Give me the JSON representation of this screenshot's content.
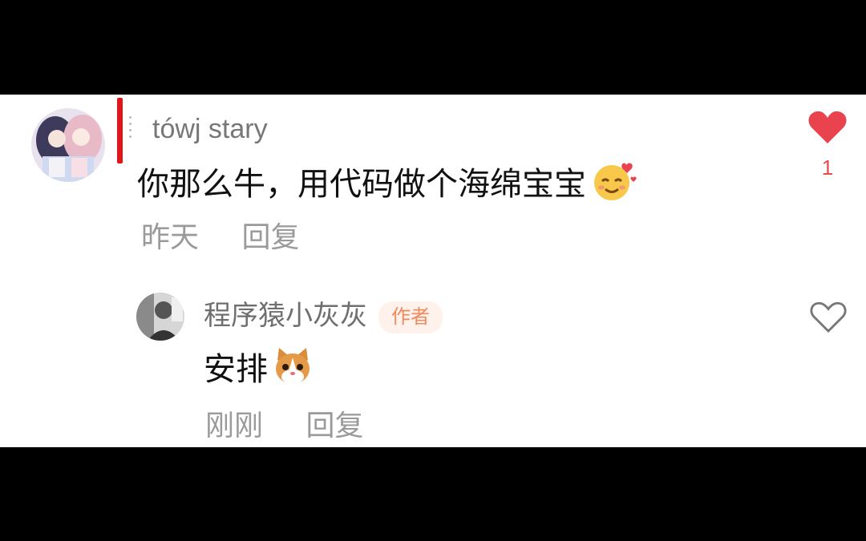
{
  "comments": [
    {
      "username": "tówj stary",
      "text": "你那么牛，用代码做个海绵宝宝",
      "emoji": "blush-hearts-emoji",
      "time": "昨天",
      "reply_label": "回复",
      "like_count": "1",
      "liked": true,
      "colors": {
        "like": "#e8434f",
        "marker": "#e0161b"
      }
    }
  ],
  "reply": {
    "username": "程序猿小灰灰",
    "badge": "作者",
    "text": "安排",
    "emoji": "cat-face-emoji",
    "time": "刚刚",
    "reply_label": "回复",
    "liked": false,
    "colors": {
      "badge_bg": "#fff1eb",
      "badge_text": "#f08a5d"
    }
  }
}
